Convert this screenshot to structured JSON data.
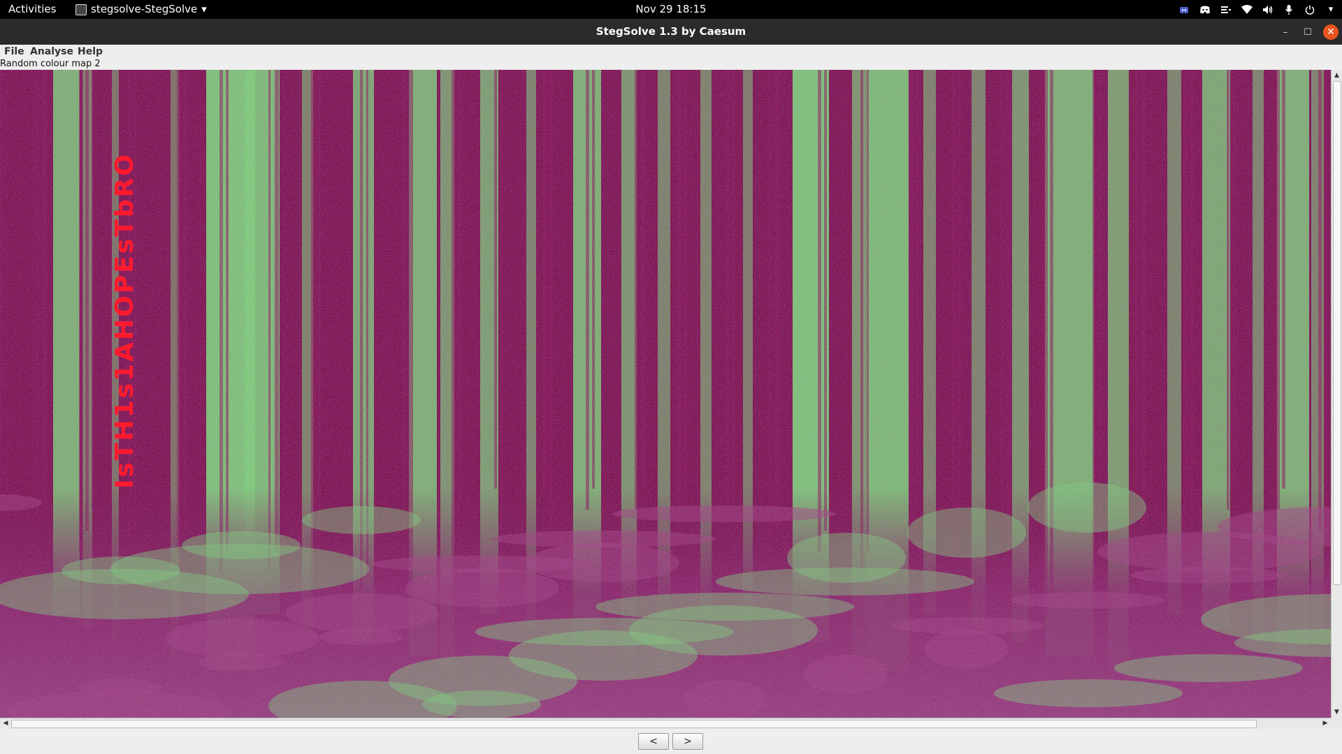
{
  "top_bar": {
    "activities_label": "Activities",
    "app_menu_label": "stegsolve-StegSolve",
    "clock": "Nov 29  18:15",
    "tray_icons": [
      "app-indicator-icon",
      "discord-icon",
      "menu-icon",
      "wifi-icon",
      "volume-icon",
      "microphone-icon",
      "power-icon",
      "chevron-down-icon"
    ]
  },
  "window": {
    "title": "StegSolve 1.3 by Caesum",
    "controls": {
      "minimize": "–",
      "maximize": "☐",
      "close": "✕"
    }
  },
  "menubar": {
    "items": [
      "File",
      "Analyse",
      "Help"
    ]
  },
  "view": {
    "mode_label": "Random colour map 2",
    "hidden_text": "IsTH1s1AHOPEsTbRO"
  },
  "navigation": {
    "prev_label": "<",
    "next_label": ">"
  },
  "colors": {
    "magenta": "#8a1a5a",
    "green": "#7ccf77",
    "hidden_text_red": "#ff1a2e",
    "close_button": "#e95420"
  }
}
